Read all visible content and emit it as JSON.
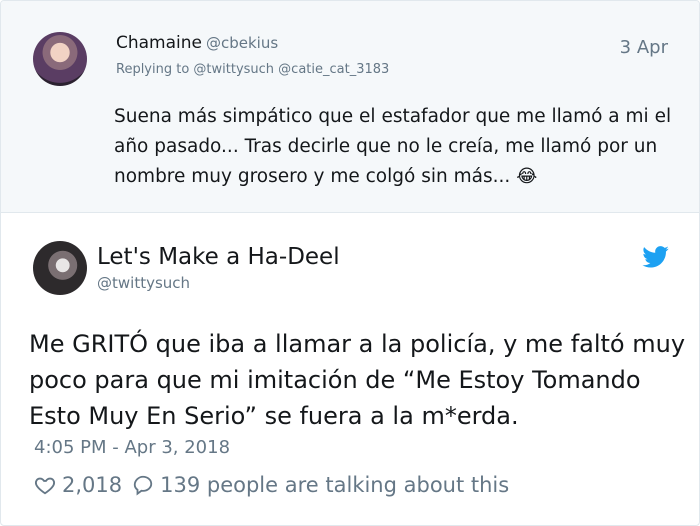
{
  "reply": {
    "author_name": "Chamaine",
    "author_handle": "@cbekius",
    "date": "3 Apr",
    "replying_to": "Replying to @twittysuch @catie_cat_3183",
    "body": "Suena más simpático que el estafador que me llamó a mi el año pasado... Tras decirle que no le creía, me llamó por un nombre muy grosero y me colgó sin más...",
    "emoji": "😂"
  },
  "tweet": {
    "author_name": "Let's Make a Ha-Deel",
    "author_handle": "@twittysuch",
    "text": "Me GRITÓ que iba a llamar a la policía, y me faltó muy poco para que mi imitación de “Me Estoy Tomando Esto Muy En Serio” se fuera a la m*erda.",
    "timestamp": "4:05 PM - Apr 3, 2018",
    "likes": "2,018",
    "talking": "139 people are talking about this"
  },
  "icons": {
    "like": "heart-icon",
    "reply": "speech-bubble-icon",
    "brand": "twitter-bird-icon"
  },
  "colors": {
    "brand": "#1da1f2",
    "secondary_text": "#657786",
    "reply_background": "#f5f8fa"
  }
}
